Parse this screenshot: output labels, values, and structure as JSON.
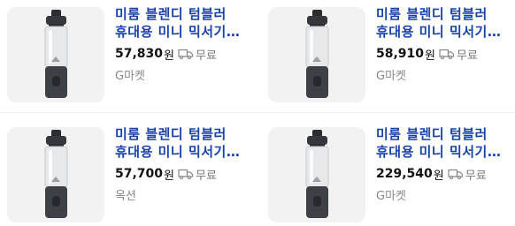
{
  "products": [
    {
      "title": "미룸 블렌디 텀블러 휴대용 미니 믹서기 충전식",
      "price": "57,830",
      "currency": "원",
      "shipping": "무료",
      "seller": "G마켓"
    },
    {
      "title": "미룸 블렌디 텀블러 휴대용 미니 믹서기 충전식",
      "price": "58,910",
      "currency": "원",
      "shipping": "무료",
      "seller": "G마켓"
    },
    {
      "title": "미룸 블렌디 텀블러 휴대용 미니 믹서기 충전식",
      "price": "57,700",
      "currency": "원",
      "shipping": "무료",
      "seller": "옥션"
    },
    {
      "title": "미룸 블렌디 텀블러 휴대용 미니 믹서기 충전식",
      "price": "229,540",
      "currency": "원",
      "shipping": "무료",
      "seller": "G마켓"
    }
  ],
  "icons": {
    "shipping": "truck-icon",
    "product": "blender-bottle-image"
  },
  "colors": {
    "title": "#1843a8",
    "price": "#111111",
    "muted": "#888888",
    "thumb_bg": "#f2f2f2"
  }
}
